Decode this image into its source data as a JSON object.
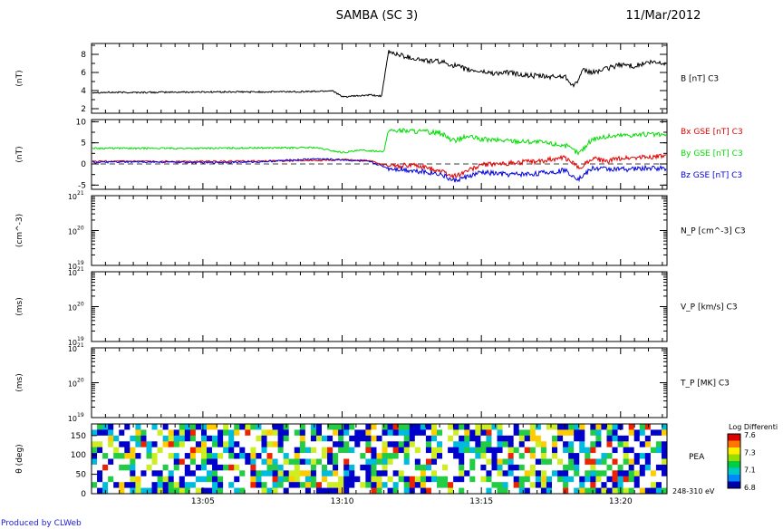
{
  "header": {
    "title": "SAMBA (SC 3)",
    "date": "11/Mar/2012"
  },
  "footer": "Produced by CLWeb",
  "time_axis": {
    "ticks": [
      "13:05",
      "13:10",
      "13:15",
      "13:20"
    ]
  },
  "chart_data": [
    {
      "type": "line",
      "panel": "B",
      "ylabel": "(nT)",
      "ylim": [
        1.5,
        9.2
      ],
      "yticks": [
        2,
        4,
        6,
        8
      ],
      "xlim": [
        "13:01:00",
        "13:21:40"
      ],
      "series": [
        {
          "name": "B [nT] C3",
          "color": "#000000",
          "x": [
            "13:01:00",
            "13:03:00",
            "13:05:00",
            "13:07:00",
            "13:09:00",
            "13:09:40",
            "13:10:00",
            "13:10:30",
            "13:11:00",
            "13:11:25",
            "13:11:40",
            "13:12:00",
            "13:12:30",
            "13:13:00",
            "13:13:30",
            "13:14:00",
            "13:14:30",
            "13:15:00",
            "13:15:30",
            "13:16:00",
            "13:16:30",
            "13:17:00",
            "13:17:30",
            "13:18:00",
            "13:18:20",
            "13:18:40",
            "13:19:00",
            "13:19:30",
            "13:20:00",
            "13:20:30",
            "13:21:00",
            "13:21:40"
          ],
          "y": [
            3.8,
            3.8,
            3.85,
            3.85,
            3.9,
            4.0,
            3.3,
            3.4,
            3.5,
            3.4,
            8.3,
            8.0,
            7.6,
            7.3,
            7.2,
            6.8,
            6.3,
            6.1,
            5.9,
            6.0,
            5.7,
            5.6,
            5.5,
            5.6,
            4.5,
            6.2,
            6.0,
            6.4,
            6.9,
            6.7,
            7.1,
            7.0
          ]
        }
      ]
    },
    {
      "type": "line",
      "panel": "B GSE",
      "ylabel": "(nT)",
      "ylim": [
        -6,
        10.5
      ],
      "yticks": [
        -5,
        0,
        5,
        10
      ],
      "xlim": [
        "13:01:00",
        "13:21:40"
      ],
      "series": [
        {
          "name": "Bx GSE [nT] C3",
          "color": "#e00000",
          "x": [
            "13:01:00",
            "13:03:00",
            "13:05:00",
            "13:07:00",
            "13:09:00",
            "13:10:00",
            "13:11:00",
            "13:11:40",
            "13:12:30",
            "13:13:30",
            "13:14:00",
            "13:14:30",
            "13:15:00",
            "13:16:00",
            "13:17:00",
            "13:18:00",
            "13:18:30",
            "13:19:00",
            "13:19:30",
            "13:20:00",
            "13:21:00",
            "13:21:40"
          ],
          "y": [
            0.6,
            0.6,
            0.6,
            0.7,
            0.8,
            1.0,
            0.8,
            -0.5,
            -0.3,
            -1.5,
            -3.0,
            -1.5,
            -0.3,
            0.2,
            0.6,
            1.5,
            -1.0,
            1.5,
            0.5,
            1.4,
            1.7,
            1.8
          ]
        },
        {
          "name": "By GSE [nT] C3",
          "color": "#00dd00",
          "x": [
            "13:01:00",
            "13:03:00",
            "13:05:00",
            "13:07:00",
            "13:08:00",
            "13:09:00",
            "13:10:00",
            "13:10:40",
            "13:11:30",
            "13:11:40",
            "13:12:30",
            "13:13:30",
            "13:14:00",
            "13:14:30",
            "13:15:00",
            "13:16:00",
            "13:17:00",
            "13:18:00",
            "13:18:30",
            "13:19:00",
            "13:20:00",
            "13:21:00",
            "13:21:40"
          ],
          "y": [
            3.7,
            3.7,
            3.7,
            3.8,
            3.8,
            3.9,
            2.7,
            3.2,
            3.0,
            8.0,
            7.8,
            7.4,
            5.5,
            6.5,
            5.8,
            5.5,
            5.2,
            4.4,
            2.5,
            6.0,
            6.8,
            7.0,
            6.8
          ]
        },
        {
          "name": "Bz GSE [nT] C3",
          "color": "#0000dd",
          "x": [
            "13:01:00",
            "13:03:00",
            "13:05:00",
            "13:07:00",
            "13:09:00",
            "13:10:00",
            "13:11:00",
            "13:11:40",
            "13:12:30",
            "13:13:30",
            "13:14:00",
            "13:14:30",
            "13:15:00",
            "13:16:00",
            "13:17:00",
            "13:18:00",
            "13:18:30",
            "13:19:00",
            "13:20:00",
            "13:21:00",
            "13:21:40"
          ],
          "y": [
            0.4,
            0.5,
            0.3,
            0.5,
            1.2,
            1.0,
            0.5,
            -1.0,
            -1.5,
            -2.3,
            -4.0,
            -3.0,
            -2.0,
            -2.5,
            -2.3,
            -1.5,
            -3.5,
            -1.0,
            -1.3,
            -1.0,
            -1.0
          ]
        }
      ]
    },
    {
      "type": "line",
      "panel": "N_P",
      "ylabel": "(cm^-3)",
      "scale": "log",
      "ylim": [
        1e+19,
        1e+21
      ],
      "yticks": [
        "10^19",
        "10^20",
        "10^21"
      ],
      "series": [
        {
          "name": "N_P [cm^-3] C3",
          "values": []
        }
      ]
    },
    {
      "type": "line",
      "panel": "V_P",
      "ylabel": "(ms)",
      "scale": "log",
      "ylim": [
        1e+19,
        1e+21
      ],
      "yticks": [
        "10^19",
        "10^20",
        "10^21"
      ],
      "series": [
        {
          "name": "V_P [km/s] C3",
          "values": []
        }
      ]
    },
    {
      "type": "line",
      "panel": "T_P",
      "ylabel": "(ms)",
      "scale": "log",
      "ylim": [
        1e+19,
        1e+21
      ],
      "yticks": [
        "10^19",
        "10^20",
        "10^21"
      ],
      "series": [
        {
          "name": "T_P [MK] C3",
          "values": []
        }
      ]
    },
    {
      "type": "heatmap",
      "panel": "PEA",
      "ylabel": "θ (deg)",
      "ylim": [
        0,
        180
      ],
      "yticks": [
        0,
        50,
        100,
        150
      ],
      "label": "PEA",
      "energy_label": "248-310 eV",
      "colorbar": {
        "title": "Log Differenti",
        "ticks": [
          "7.6",
          "7.3",
          "7.1",
          "6.8"
        ],
        "range": [
          6.8,
          7.6
        ]
      }
    }
  ]
}
